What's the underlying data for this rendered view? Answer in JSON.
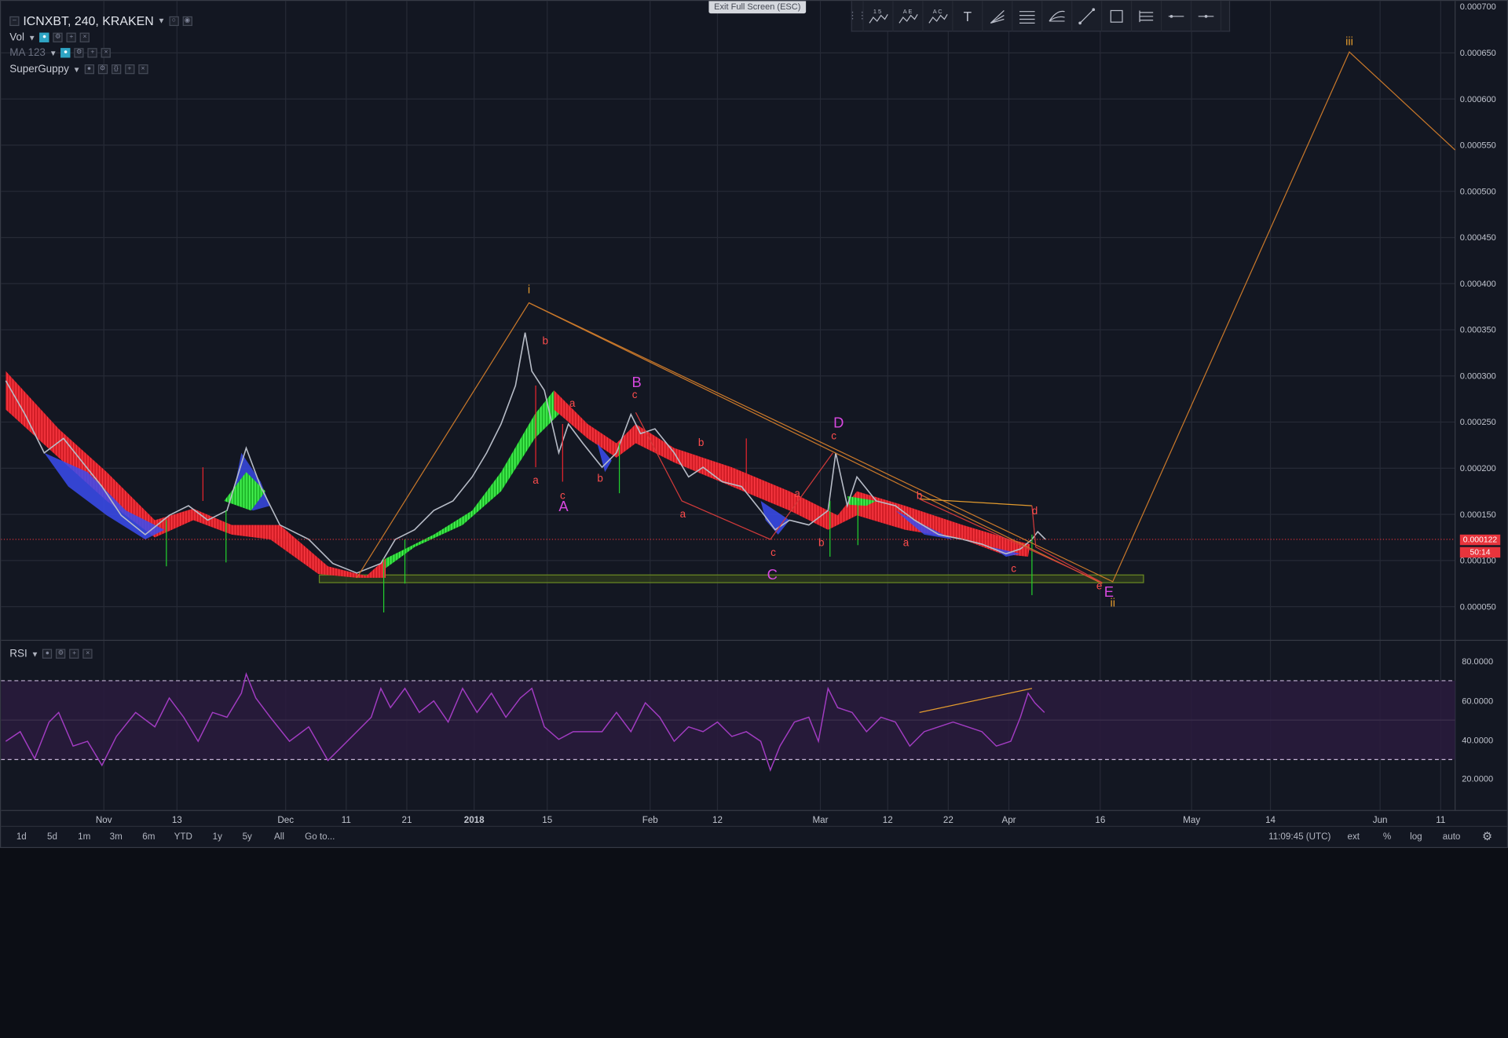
{
  "header": {
    "symbol": "ICNXBT, 240, KRAKEN",
    "exit_fullscreen": "Exit Full Screen (ESC)",
    "indicators": [
      {
        "name": "Vol",
        "enabled": true
      },
      {
        "name": "MA 123",
        "enabled": false
      },
      {
        "name": "SuperGuppy",
        "enabled": true
      }
    ]
  },
  "toolbar": {
    "tools": [
      "1 5",
      "A E",
      "A C",
      "T",
      "fib-fan",
      "parallel-channel",
      "pitchfork",
      "trend-line",
      "rectangle",
      "frame",
      "horizontal-ray",
      "horizontal-line"
    ]
  },
  "price_axis": {
    "labels": [
      "0.000700",
      "0.000650",
      "0.000600",
      "0.000550",
      "0.000500",
      "0.000450",
      "0.000400",
      "0.000350",
      "0.000300",
      "0.000250",
      "0.000200",
      "0.000150",
      "0.000100",
      "0.000050"
    ],
    "current_price": "0.000122",
    "countdown": "50:14"
  },
  "rsi_axis": {
    "title": "RSI",
    "labels": [
      "80.0000",
      "60.0000",
      "40.0000",
      "20.0000"
    ]
  },
  "time_axis": {
    "labels": [
      "Nov",
      "13",
      "Dec",
      "11",
      "21",
      "2018",
      "15",
      "Feb",
      "12",
      "Mar",
      "12",
      "22",
      "Apr",
      "16",
      "May",
      "14",
      "Jun",
      "11"
    ]
  },
  "wave_labels": {
    "orange": [
      "i",
      "ii",
      "iii"
    ],
    "pink": [
      "A",
      "B",
      "C",
      "D",
      "E"
    ],
    "red": [
      "a",
      "b",
      "c",
      "a",
      "b",
      "c",
      "a",
      "b",
      "c",
      "a",
      "b",
      "c",
      "a",
      "b",
      "c",
      "d",
      "e"
    ]
  },
  "bottom_bar": {
    "ranges": [
      "1d",
      "5d",
      "1m",
      "3m",
      "6m",
      "YTD",
      "1y",
      "5y",
      "All"
    ],
    "goto": "Go to...",
    "time": "11:09:45 (UTC)",
    "ext": "ext",
    "percent": "%",
    "log": "log",
    "auto": "auto"
  },
  "colors": {
    "background": "#131722",
    "bear_ribbon": "#e8242d",
    "bull_ribbon": "#22d12e",
    "fast_ribbon": "#3b4cf0",
    "rsi": "#9c27b0",
    "wave_orange": "#e39b2e",
    "wave_pink": "#d848e0",
    "wave_red": "#ff4d4d",
    "price_line": "#e8343c",
    "support_zone": "#6a8a22"
  },
  "chart_data": {
    "type": "line",
    "title": "ICNXBT, 240, KRAKEN",
    "price_series": {
      "name": "ICNXBT",
      "x": [
        "Oct 26",
        "Nov 1",
        "Nov 13",
        "Nov 24",
        "Dec 1",
        "Dec 11",
        "Dec 21",
        "Jan 1",
        "Jan 10",
        "Jan 15",
        "Jan 22",
        "Jan 27",
        "Feb 1",
        "Feb 12",
        "Feb 22",
        "Mar 1",
        "Mar 5",
        "Mar 12",
        "Mar 22",
        "Apr 1",
        "Apr 4",
        "Apr 7"
      ],
      "values": [
        0.0003,
        0.0002,
        0.000155,
        0.000215,
        0.000145,
        9e-05,
        0.000125,
        0.000175,
        0.00036,
        0.000225,
        0.0002,
        0.00026,
        0.000215,
        0.000175,
        0.00013,
        0.00014,
        0.000215,
        0.00015,
        0.000125,
        0.000107,
        0.000155,
        0.000122
      ]
    },
    "rsi_series": {
      "name": "RSI",
      "values": [
        42,
        56,
        36,
        52,
        60,
        72,
        40,
        46,
        30,
        55,
        66,
        58,
        70,
        47,
        60,
        40,
        62,
        30,
        70,
        45,
        66,
        52
      ]
    },
    "projection": {
      "x": [
        "Jan 12",
        "Apr 17",
        "May 27",
        "Jun 11"
      ],
      "values": [
        0.00038,
        6.5e-05,
        0.00065,
        0.00054
      ]
    },
    "ylim": [
      0.0,
      0.0007
    ],
    "rsi_ylim": [
      0,
      100
    ]
  }
}
